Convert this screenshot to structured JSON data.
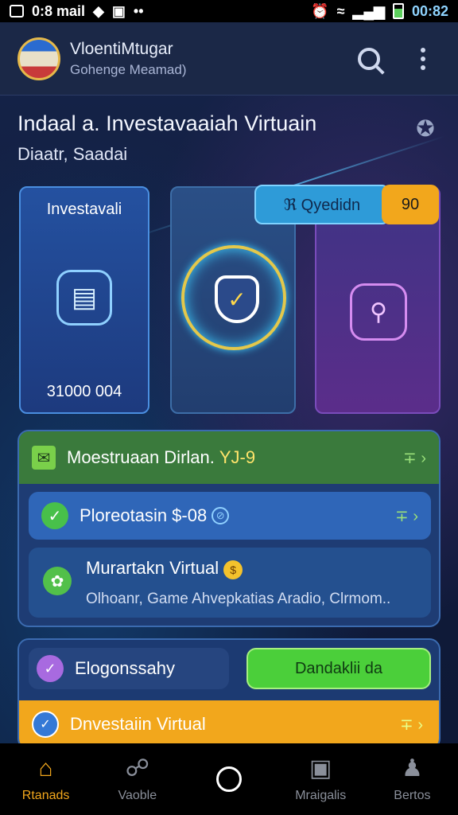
{
  "status_bar": {
    "left_text": "0:8 mail",
    "time": "00:82"
  },
  "app_header": {
    "title": "VloentiMtugar",
    "subtitle": "Gohenge Meamad)"
  },
  "heading": {
    "title": "Indaal a. Investavaaiah Virtuain",
    "subtitle": "Diaatr, Saadai"
  },
  "cards": {
    "left": {
      "label": "Investavali",
      "value": "31000 004"
    },
    "chip": {
      "label": "ℜ Qyedidn",
      "badge": "90"
    }
  },
  "list": {
    "row1": {
      "label": "Moestruaan Dirlan.",
      "suffix": "YJ-9"
    },
    "row2": {
      "label": "Ploreotasin $-08"
    },
    "row3": {
      "title": "Murartakn Virtual",
      "desc": "Olhoanr, Game Ahvepkatias Aradio, Clrmom.."
    }
  },
  "bottom_panel": {
    "left_label": "Elogonssahy",
    "button_label": "Dandaklii da",
    "orange_label": "Dnvestaiin Virtual"
  },
  "nav": {
    "items": [
      {
        "label": "Rtanads",
        "icon": "home-icon",
        "active": true
      },
      {
        "label": "Vaoble",
        "icon": "network-icon",
        "active": false
      },
      {
        "label": "",
        "icon": "home-circle-icon",
        "active": false
      },
      {
        "label": "Mraigalis",
        "icon": "box-icon",
        "active": false
      },
      {
        "label": "Bertos",
        "icon": "person-icon",
        "active": false
      }
    ]
  },
  "colors": {
    "accent_orange": "#f2a71c",
    "accent_green": "#4bcf3a",
    "panel_blue": "#1e3c74"
  }
}
